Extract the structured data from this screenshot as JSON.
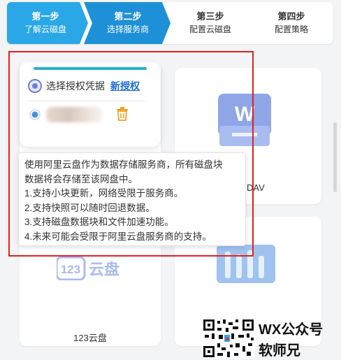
{
  "steps": [
    {
      "title": "第一步",
      "subtitle": "了解云磁盘",
      "state": "done"
    },
    {
      "title": "第二步",
      "subtitle": "选择服务商",
      "state": "active"
    },
    {
      "title": "第三步",
      "subtitle": "配置云磁盘",
      "state": "pending"
    },
    {
      "title": "第四步",
      "subtitle": "配置策略",
      "state": "pending"
    }
  ],
  "colors": {
    "step_active": "#1e90d8",
    "step_done": "#2aa7e6",
    "accent_bar": "#25b4c6",
    "link": "#1a6cd6",
    "highlight_border": "#e02020",
    "trash": "#f0a020"
  },
  "auth_card": {
    "label": "选择授权凭据",
    "new_auth_link": "新授权",
    "credential_name": "(blurred)"
  },
  "tooltip": {
    "lines": [
      "使用阿里云盘作为数据存储服务商，所有磁盘块",
      "数据将会存储至该网盘中。",
      "1.支持小块更新，网络受限于服务商。",
      "2.支持快照可以随时回退数据。",
      "3.支持磁盘数据块和文件加速功能。",
      "4.未来可能会受限于阿里云盘服务商的支持。"
    ]
  },
  "providers": [
    {
      "name": "WebDAV",
      "visible_label": "DAV",
      "icon": "webdav-w-icon"
    },
    {
      "name": "123云盘",
      "visible_label": "123云盘",
      "icon": "123-cloud-icon",
      "logo_text": "123云盘"
    },
    {
      "name": "other",
      "visible_label": "",
      "icon": "bars-icon"
    }
  ],
  "watermark": {
    "line1": "WX公众号",
    "line2": "软师兄"
  }
}
